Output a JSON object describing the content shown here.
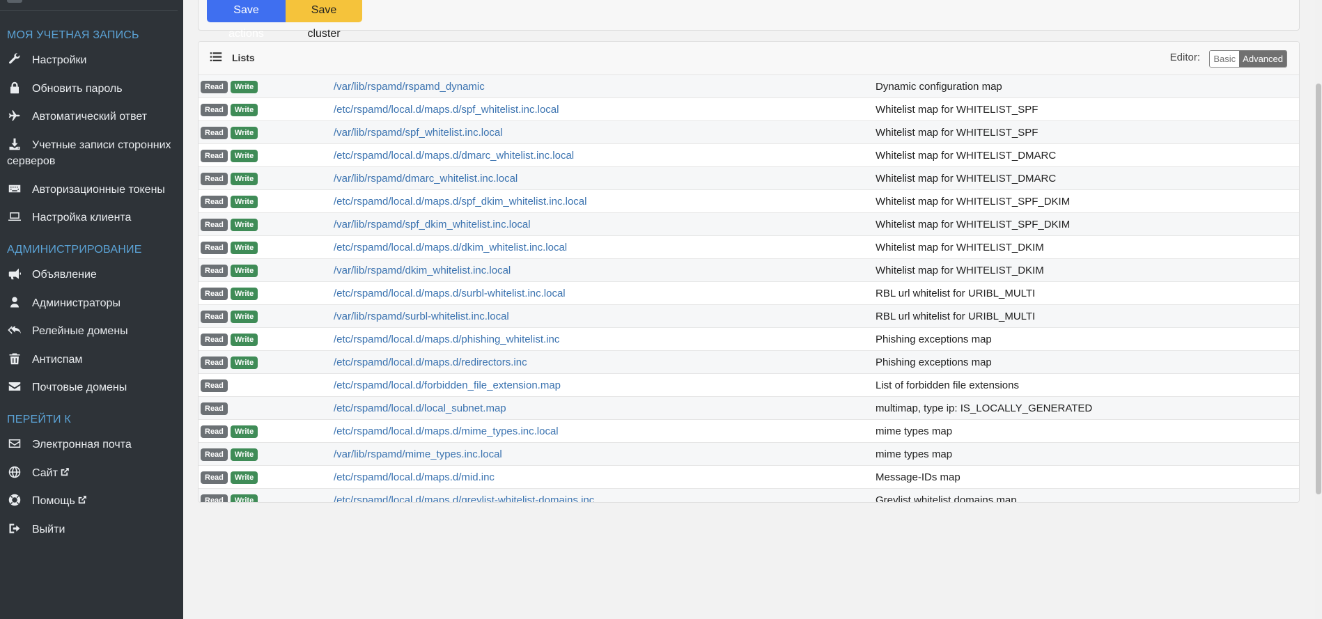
{
  "sidebar": {
    "section_account": "Моя учетная запись",
    "account_items": [
      {
        "label": "Настройки",
        "icon": "wrench-icon"
      },
      {
        "label": "Обновить пароль",
        "icon": "lock-icon"
      },
      {
        "label": "Автоматический ответ",
        "icon": "plane-icon"
      },
      {
        "label": "Учетные записи сторонних серверов",
        "icon": "download-icon"
      },
      {
        "label": "Авторизационные токены",
        "icon": "keyboard-icon"
      },
      {
        "label": "Настройка клиента",
        "icon": "laptop-icon"
      }
    ],
    "section_admin": "Администрирование",
    "admin_items": [
      {
        "label": "Объявление",
        "icon": "megaphone-icon"
      },
      {
        "label": "Администраторы",
        "icon": "user-icon"
      },
      {
        "label": "Релейные домены",
        "icon": "reply-all-icon"
      },
      {
        "label": "Антиспам",
        "icon": "trash-icon"
      },
      {
        "label": "Почтовые домены",
        "icon": "envelope-icon"
      }
    ],
    "section_goto": "Перейти к",
    "goto_items": [
      {
        "label": "Электронная почта",
        "icon": "envelope-outline-icon"
      },
      {
        "label": "Сайт",
        "icon": "globe-icon"
      },
      {
        "label": "Помощь",
        "icon": "lifebuoy-icon"
      },
      {
        "label": "Выйти",
        "icon": "sign-out-icon"
      }
    ]
  },
  "toolbar": {
    "save_actions_label": "Save actions",
    "save_cluster_label": "Save cluster"
  },
  "lists": {
    "title": "Lists",
    "editor_label": "Editor:",
    "editor_basic": "Basic",
    "editor_advanced": "Advanced",
    "read_label": "Read",
    "write_label": "Write",
    "rows": [
      {
        "path": "/var/lib/rspamd/rspamd_dynamic",
        "desc": "Dynamic configuration map",
        "write": true
      },
      {
        "path": "/etc/rspamd/local.d/maps.d/spf_whitelist.inc.local",
        "desc": "Whitelist map for WHITELIST_SPF",
        "write": true
      },
      {
        "path": "/var/lib/rspamd/spf_whitelist.inc.local",
        "desc": "Whitelist map for WHITELIST_SPF",
        "write": true
      },
      {
        "path": "/etc/rspamd/local.d/maps.d/dmarc_whitelist.inc.local",
        "desc": "Whitelist map for WHITELIST_DMARC",
        "write": true
      },
      {
        "path": "/var/lib/rspamd/dmarc_whitelist.inc.local",
        "desc": "Whitelist map for WHITELIST_DMARC",
        "write": true
      },
      {
        "path": "/etc/rspamd/local.d/maps.d/spf_dkim_whitelist.inc.local",
        "desc": "Whitelist map for WHITELIST_SPF_DKIM",
        "write": true
      },
      {
        "path": "/var/lib/rspamd/spf_dkim_whitelist.inc.local",
        "desc": "Whitelist map for WHITELIST_SPF_DKIM",
        "write": true
      },
      {
        "path": "/etc/rspamd/local.d/maps.d/dkim_whitelist.inc.local",
        "desc": "Whitelist map for WHITELIST_DKIM",
        "write": true
      },
      {
        "path": "/var/lib/rspamd/dkim_whitelist.inc.local",
        "desc": "Whitelist map for WHITELIST_DKIM",
        "write": true
      },
      {
        "path": "/etc/rspamd/local.d/maps.d/surbl-whitelist.inc.local",
        "desc": "RBL url whitelist for URIBL_MULTI",
        "write": true
      },
      {
        "path": "/var/lib/rspamd/surbl-whitelist.inc.local",
        "desc": "RBL url whitelist for URIBL_MULTI",
        "write": true
      },
      {
        "path": "/etc/rspamd/local.d/maps.d/phishing_whitelist.inc",
        "desc": "Phishing exceptions map",
        "write": true
      },
      {
        "path": "/etc/rspamd/local.d/maps.d/redirectors.inc",
        "desc": "Phishing exceptions map",
        "write": true
      },
      {
        "path": "/etc/rspamd/local.d/forbidden_file_extension.map",
        "desc": "List of forbidden file extensions",
        "write": false
      },
      {
        "path": "/etc/rspamd/local.d/local_subnet.map",
        "desc": "multimap, type ip: IS_LOCALLY_GENERATED",
        "write": false
      },
      {
        "path": "/etc/rspamd/local.d/maps.d/mime_types.inc.local",
        "desc": "mime types map",
        "write": true
      },
      {
        "path": "/var/lib/rspamd/mime_types.inc.local",
        "desc": "mime types map",
        "write": true
      },
      {
        "path": "/etc/rspamd/local.d/maps.d/mid.inc",
        "desc": "Message-IDs map",
        "write": true
      },
      {
        "path": "/etc/rspamd/local.d/maps.d/greylist-whitelist-domains.inc",
        "desc": "Greylist whitelist domains map",
        "write": true
      }
    ]
  },
  "colors": {
    "sidebar_bg": "#2e3338",
    "heading": "#5ba3d6",
    "primary_button": "#3f6ff0",
    "warning_button": "#f5c33b",
    "read_badge": "#6c7175",
    "write_badge": "#3f8c57",
    "link": "#3b73b0"
  }
}
